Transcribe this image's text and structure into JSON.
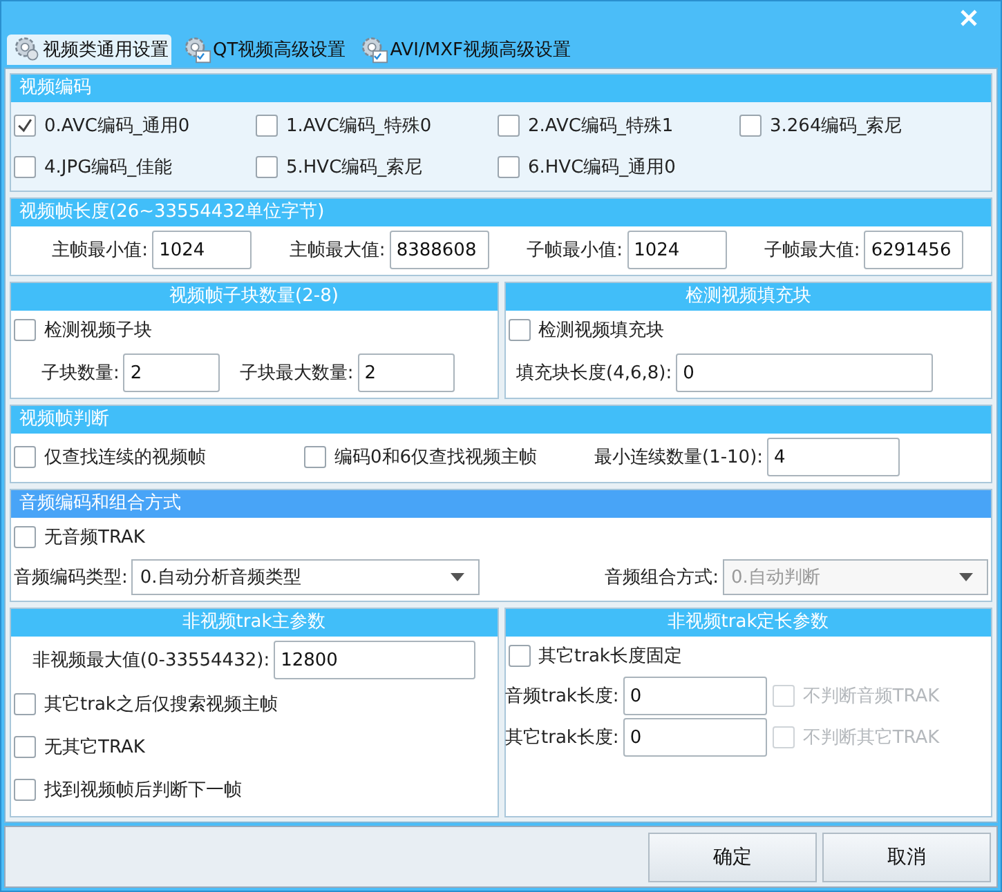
{
  "tabs": [
    {
      "label": "视频类通用设置",
      "selected": true
    },
    {
      "label": "QT视频高级设置",
      "selected": false
    },
    {
      "label": "AVI/MXF视频高级设置",
      "selected": false
    }
  ],
  "video_codec": {
    "title": "视频编码",
    "options": [
      {
        "label": "0.AVC编码_通用0",
        "checked": true
      },
      {
        "label": "1.AVC编码_特殊0",
        "checked": false
      },
      {
        "label": "2.AVC编码_特殊1",
        "checked": false
      },
      {
        "label": "3.264编码_索尼",
        "checked": false
      },
      {
        "label": "4.JPG编码_佳能",
        "checked": false
      },
      {
        "label": "5.HVC编码_索尼",
        "checked": false
      },
      {
        "label": "6.HVC编码_通用0",
        "checked": false
      }
    ]
  },
  "frame_length": {
    "title": "视频帧长度(26~33554432单位字节)",
    "fields": [
      {
        "label": "主帧最小值:",
        "value": "1024"
      },
      {
        "label": "主帧最大值:",
        "value": "8388608"
      },
      {
        "label": "子帧最小值:",
        "value": "1024"
      },
      {
        "label": "子帧最大值:",
        "value": "6291456"
      }
    ]
  },
  "subblock": {
    "title": "视频帧子块数量(2-8)",
    "checkbox": {
      "label": "检测视频子块",
      "checked": false
    },
    "fields": [
      {
        "label": "子块数量:",
        "value": "2"
      },
      {
        "label": "子块最大数量:",
        "value": "2"
      }
    ]
  },
  "padding": {
    "title": "检测视频填充块",
    "checkbox": {
      "label": "检测视频填充块",
      "checked": false
    },
    "fields": [
      {
        "label": "填充块长度(4,6,8):",
        "value": "0"
      }
    ]
  },
  "frame_judge": {
    "title": "视频帧判断",
    "checkboxes": [
      {
        "label": "仅查找连续的视频帧",
        "checked": false
      },
      {
        "label": "编码0和6仅查找视频主帧",
        "checked": false
      }
    ],
    "fields": [
      {
        "label": "最小连续数量(1-10):",
        "value": "4"
      }
    ]
  },
  "audio": {
    "title": "音频编码和组合方式",
    "checkbox": {
      "label": "无音频TRAK",
      "checked": false
    },
    "dropdowns": [
      {
        "label": "音频编码类型:",
        "value": "0.自动分析音频类型",
        "disabled": false
      },
      {
        "label": "音频组合方式:",
        "value": "0.自动判断",
        "disabled": true
      }
    ]
  },
  "nonvideo_main": {
    "title": "非视频trak主参数",
    "fields": [
      {
        "label": "非视频最大值(0-33554432):",
        "value": "12800"
      }
    ],
    "checkboxes": [
      {
        "label": "其它trak之后仅搜索视频主帧",
        "checked": false
      },
      {
        "label": "无其它TRAK",
        "checked": false
      },
      {
        "label": "找到视频帧后判断下一帧",
        "checked": false
      }
    ]
  },
  "nonvideo_fixed": {
    "title": "非视频trak定长参数",
    "checkbox": {
      "label": "其它trak长度固定",
      "checked": false
    },
    "rows": [
      {
        "label": "音频trak长度:",
        "value": "0",
        "option": {
          "label": "不判断音频TRAK",
          "checked": false,
          "disabled": true
        }
      },
      {
        "label": "其它trak长度:",
        "value": "0",
        "option": {
          "label": "不判断其它TRAK",
          "checked": false,
          "disabled": true
        }
      }
    ]
  },
  "buttons": [
    "确定",
    "取消"
  ]
}
